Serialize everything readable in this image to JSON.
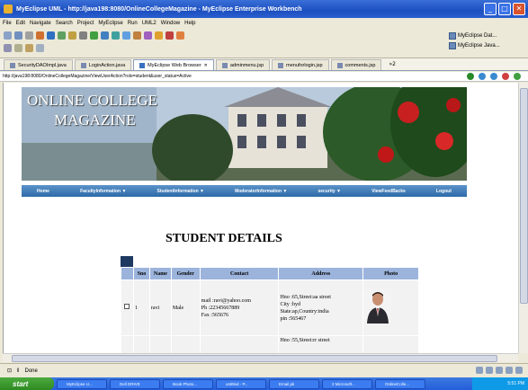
{
  "window": {
    "title": "MyEclipse UML - http://java198:8080/OnlineCollegeMagazine - MyEclipse Enterprise Workbench",
    "minimize": "_",
    "maximize": "□",
    "close": "✕"
  },
  "menu": [
    "File",
    "Edit",
    "Navigate",
    "Search",
    "Project",
    "MyEclipse",
    "Run",
    "UML2",
    "Window",
    "Help"
  ],
  "perspectives": [
    "MyEclipse Dat...",
    "MyEclipse Java..."
  ],
  "editor_tabs": [
    {
      "label": "SecurityDAOImpl.java",
      "active": false
    },
    {
      "label": "LoginAction.java",
      "active": false
    },
    {
      "label": "MyEclipse Web Browser",
      "active": true
    },
    {
      "label": "adminmenu.jsp",
      "active": false
    },
    {
      "label": "menuforlogin.jsp",
      "active": false
    },
    {
      "label": "comments.jsp",
      "active": false
    }
  ],
  "tab_overflow": "»2",
  "browser": {
    "url": "http://java198:8080/OnlineCollegeMagazine/ViewUserAction?role=student&user_status=Active"
  },
  "site": {
    "logo_line1": "ONLINE COLLEGE",
    "logo_line2": "MAGAZINE",
    "nav": [
      "Home",
      "FacultyInformation ▼",
      "StudentInformation ▼",
      "ModeratorInformation ▼",
      "security ▼",
      "ViewFeedBacks",
      "Logout"
    ],
    "page_title": "STUDENT DETAILS"
  },
  "table": {
    "headers": [
      "",
      "Sno",
      "Name",
      "Gender",
      "Contact",
      "Address",
      "Photo"
    ],
    "rows": [
      {
        "sno": "1",
        "name": "ravi",
        "gender": "Male",
        "contact": [
          "mail :ravi@yahoo.com",
          "Ph :22345667889",
          "Fax :565676"
        ],
        "address": [
          "Hno :65,Street:aa street",
          "City :hyd",
          "State:ap,Country:india",
          "pin :565467"
        ]
      },
      {
        "sno": "",
        "name": "",
        "gender": "",
        "contact": [],
        "address": [
          "Hno :55,Street:rr street"
        ]
      }
    ]
  },
  "status": {
    "text": "Done"
  },
  "taskbar": {
    "start": "start",
    "tasks": [
      "MyEclipse U...",
      "Dell DRIVE",
      "Book Photo...",
      "untitled - P...",
      "Email.pk",
      "2 Microsoft...",
      "OnlineColle..."
    ],
    "clock": "5:51 PM"
  },
  "colors": {
    "nav_bar": "#2d6aa8",
    "table_header": "#9cb4dc",
    "title_bar": "#1c4fc0"
  }
}
